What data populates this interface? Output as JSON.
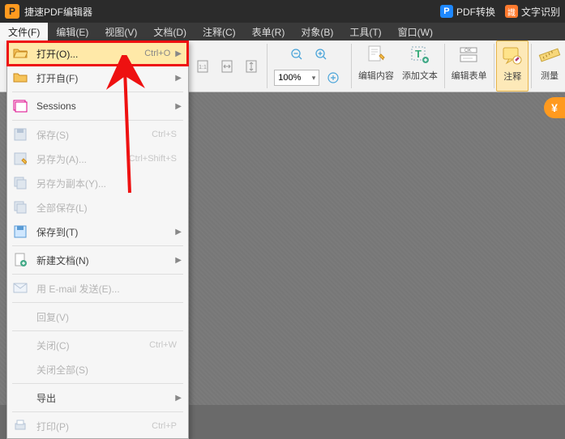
{
  "title": "捷速PDF编辑器",
  "title_right": {
    "pdf_convert": "PDF转换",
    "ocr": "文字识别"
  },
  "menus": [
    "文件(F)",
    "编辑(E)",
    "视图(V)",
    "文档(D)",
    "注释(C)",
    "表单(R)",
    "对象(B)",
    "工具(T)",
    "窗口(W)"
  ],
  "toolbar": {
    "zoom_value": "100%",
    "edit_content": "编辑内容",
    "add_text": "添加文本",
    "edit_form": "编辑表单",
    "annotate": "注释",
    "measure": "测量"
  },
  "file_menu": {
    "open": {
      "label": "打开(O)...",
      "shortcut": "Ctrl+O"
    },
    "open_from": {
      "label": "打开自(F)"
    },
    "sessions": {
      "label": "Sessions"
    },
    "save": {
      "label": "保存(S)",
      "shortcut": "Ctrl+S"
    },
    "save_as": {
      "label": "另存为(A)...",
      "shortcut": "Ctrl+Shift+S"
    },
    "save_copy": {
      "label": "另存为副本(Y)..."
    },
    "save_all": {
      "label": "全部保存(L)"
    },
    "save_to": {
      "label": "保存到(T)"
    },
    "new_doc": {
      "label": "新建文档(N)"
    },
    "email": {
      "label": "用 E-mail 发送(E)..."
    },
    "reply": {
      "label": "回复(V)"
    },
    "close": {
      "label": "关闭(C)",
      "shortcut": "Ctrl+W"
    },
    "close_all": {
      "label": "关闭全部(S)"
    },
    "export": {
      "label": "导出"
    },
    "print": {
      "label": "打印(P)",
      "shortcut": "Ctrl+P"
    }
  },
  "currency": "¥"
}
